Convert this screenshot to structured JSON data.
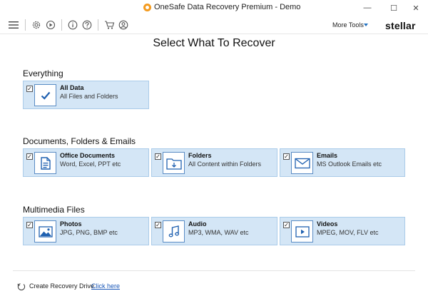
{
  "window": {
    "title": "OneSafe Data Recovery Premium - Demo",
    "min_glyph": "—",
    "max_glyph": "☐",
    "close_glyph": "✕"
  },
  "toolbar": {
    "icons": [
      "menu-icon",
      "gear-icon",
      "play-icon",
      "info-icon",
      "help-icon",
      "cart-icon",
      "user-icon"
    ],
    "more_tools_label": "More Tools",
    "brand": "stellar"
  },
  "main": {
    "title": "Select What To Recover",
    "sections": [
      {
        "title": "Everything",
        "cards": [
          {
            "title": "All Data",
            "subtitle": "All Files and Folders",
            "checked": true,
            "icon": "check-icon"
          }
        ]
      },
      {
        "title": "Documents, Folders & Emails",
        "cards": [
          {
            "title": "Office Documents",
            "subtitle": "Word, Excel, PPT etc",
            "checked": true,
            "icon": "document-icon"
          },
          {
            "title": "Folders",
            "subtitle": "All Content within Folders",
            "checked": true,
            "icon": "folder-icon"
          },
          {
            "title": "Emails",
            "subtitle": "MS Outlook Emails etc",
            "checked": true,
            "icon": "email-icon"
          }
        ]
      },
      {
        "title": "Multimedia Files",
        "cards": [
          {
            "title": "Photos",
            "subtitle": "JPG, PNG, BMP etc",
            "checked": true,
            "icon": "photo-icon"
          },
          {
            "title": "Audio",
            "subtitle": "MP3, WMA, WAV etc",
            "checked": true,
            "icon": "music-icon"
          },
          {
            "title": "Videos",
            "subtitle": "MPEG, MOV, FLV etc",
            "checked": true,
            "icon": "video-icon"
          }
        ]
      }
    ]
  },
  "footer": {
    "create_drive_label": "Create Recovery Drive",
    "link_label": "Click here"
  },
  "colors": {
    "card_bg": "#d4e6f6",
    "card_border": "#aacbe9",
    "accent": "#1f70c1",
    "link": "#1a57b8",
    "logo": "#f39a1e"
  }
}
